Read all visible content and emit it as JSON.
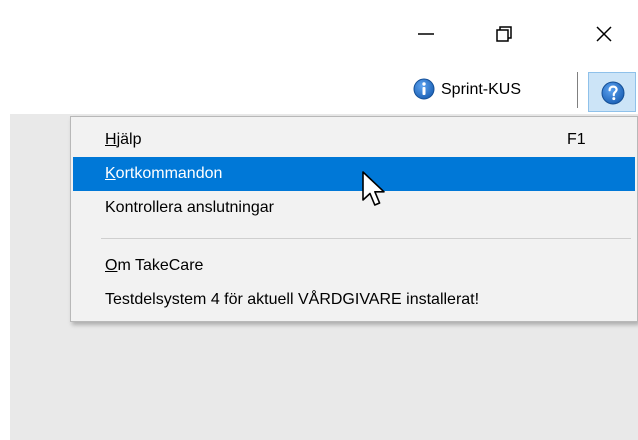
{
  "window_controls": {
    "minimize_icon": "minimize-icon",
    "restore_icon": "restore-icon",
    "close_icon": "close-icon"
  },
  "toolbar": {
    "sprint_label": "Sprint-KUS",
    "info_icon": "info-icon",
    "help_icon": "help-icon"
  },
  "help_menu": {
    "items": [
      {
        "label_mnemonic": "H",
        "label_rest": "jälp",
        "accelerator": "F1"
      },
      {
        "label_mnemonic": "K",
        "label_rest": "ortkommandon",
        "accelerator": ""
      },
      {
        "label": "Kontrollera anslutningar"
      },
      {
        "label_mnemonic": "O",
        "label_rest": "m TakeCare"
      },
      {
        "label": "Testdelsystem 4 för aktuell VÅRDGIVARE installerat!"
      }
    ],
    "selected_index": 1
  },
  "colors": {
    "selection": "#0078d7",
    "menu_bg": "#f2f2f2",
    "content_bg": "#e9e9e9",
    "info_blue": "#1a5fb4",
    "help_button_bg": "#cce4f7"
  }
}
